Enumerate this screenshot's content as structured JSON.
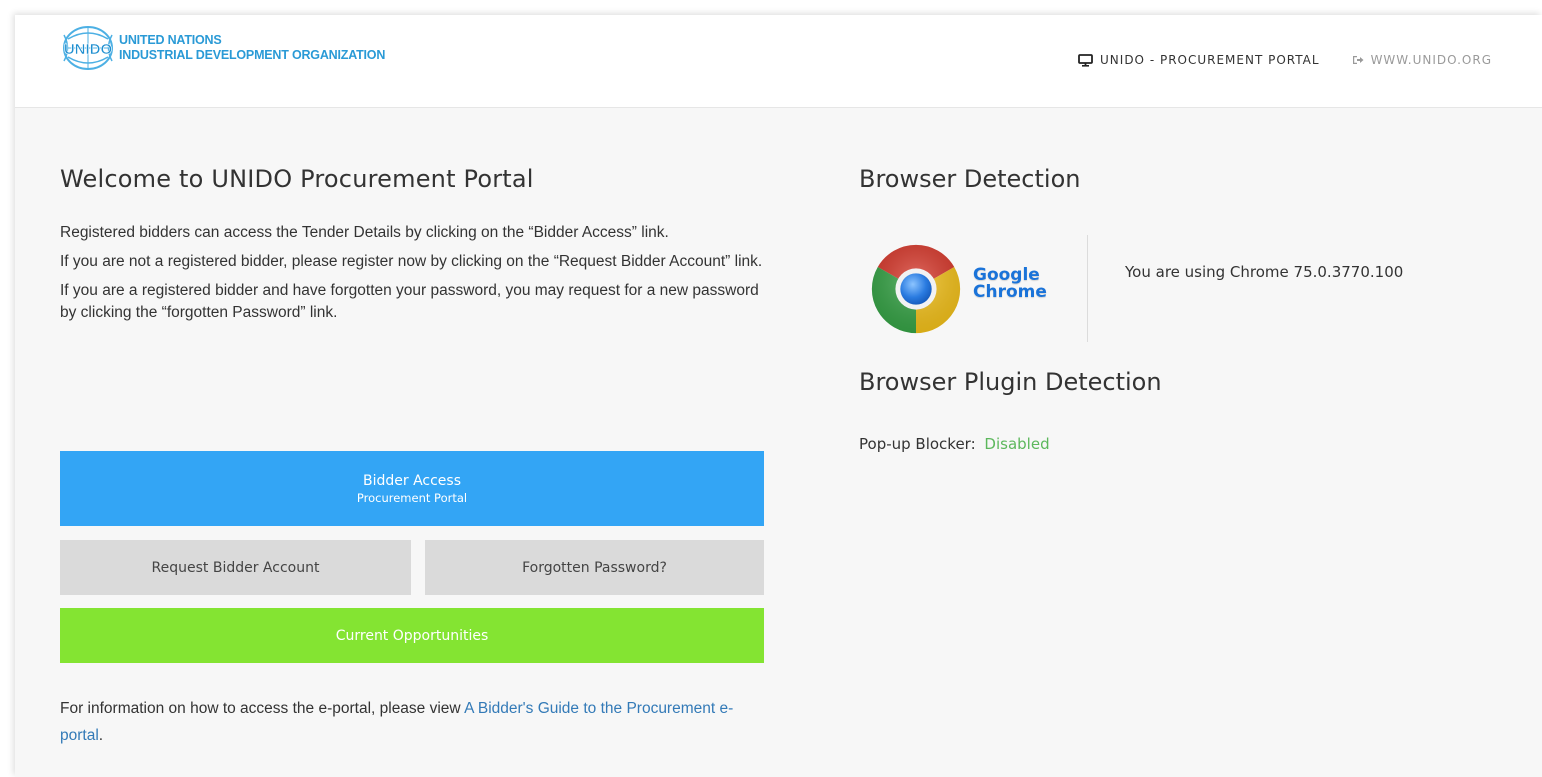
{
  "header": {
    "logo_mark": "UNIDO",
    "logo_line1": "UNITED NATIONS",
    "logo_line2": "INDUSTRIAL DEVELOPMENT ORGANIZATION",
    "nav": {
      "portal_label": "UNIDO - PROCUREMENT PORTAL",
      "portal_icon": "monitor-icon",
      "site_label": "WWW.UNIDO.ORG",
      "site_icon": "external-link-icon"
    }
  },
  "welcome": {
    "title": "Welcome to UNIDO Procurement Portal",
    "paragraphs": [
      "Registered bidders can access the Tender Details by clicking on the “Bidder Access” link.",
      "If you are not a registered bidder, please register now by clicking on the “Request Bidder Account” link.",
      "If you are a registered bidder and have forgotten your password, you may request for a new password by clicking the “forgotten Password” link."
    ],
    "buttons": {
      "bidder_access": "Bidder Access",
      "bidder_access_sub": "Procurement Portal",
      "request_account": "Request Bidder Account",
      "forgotten_password": "Forgotten Password?",
      "current_opportunities": "Current Opportunities"
    },
    "guide_prefix": "For information on how to access the e-portal, please view ",
    "guide_link": "A Bidder's Guide to the Procurement e-portal",
    "guide_suffix": "."
  },
  "browser": {
    "title": "Browser Detection",
    "logo_line1": "Google",
    "logo_line2": "Chrome",
    "using_text": "You are using Chrome 75.0.3770.100",
    "plugin_title": "Browser Plugin Detection",
    "popup_label": "Pop-up Blocker:",
    "popup_status": "Disabled"
  },
  "colors": {
    "primary_blue": "#33a5f5",
    "gray_button": "#dadada",
    "green_button": "#84e432",
    "link_blue": "#337ab7",
    "status_green": "#5cb85c",
    "unido_blue": "#2a9ad6"
  }
}
